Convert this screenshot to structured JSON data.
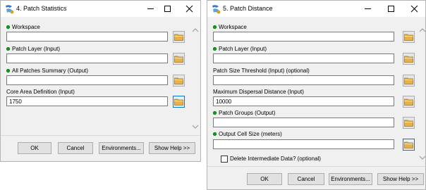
{
  "colors": {
    "required_dot": "#11a11a",
    "folder": "#e8b24a"
  },
  "dialog1": {
    "title": "4. Patch Statistics",
    "params": [
      {
        "label": "Workspace",
        "value": "",
        "required": true
      },
      {
        "label": "Patch Layer (Input)",
        "value": "",
        "required": true
      },
      {
        "label": "All Patches Summary (Output)",
        "value": "",
        "required": true
      },
      {
        "label": "Core Area Definition (Input)",
        "value": "1750",
        "required": false
      }
    ],
    "buttons": {
      "ok": "OK",
      "cancel": "Cancel",
      "environments": "Environments...",
      "show_help": "Show Help >>"
    }
  },
  "dialog2": {
    "title": "5. Patch Distance",
    "params": [
      {
        "label": "Workspace",
        "value": "",
        "required": true
      },
      {
        "label": "Patch Layer (Input)",
        "value": "",
        "required": true
      },
      {
        "label": "Patch Size Threshold (Input) (optional)",
        "value": "",
        "required": false
      },
      {
        "label": "Maximum Dispersal Distance (Input)",
        "value": "10000",
        "required": false
      },
      {
        "label": "Patch Groups (Output)",
        "value": "",
        "required": true
      },
      {
        "label": "Output Cell Size (meters)",
        "value": "",
        "required": true
      }
    ],
    "checkbox_label": "Delete Intermediate Data? (optional)",
    "buttons": {
      "ok": "OK",
      "cancel": "Cancel",
      "environments": "Environments...",
      "show_help": "Show Help >>"
    }
  }
}
